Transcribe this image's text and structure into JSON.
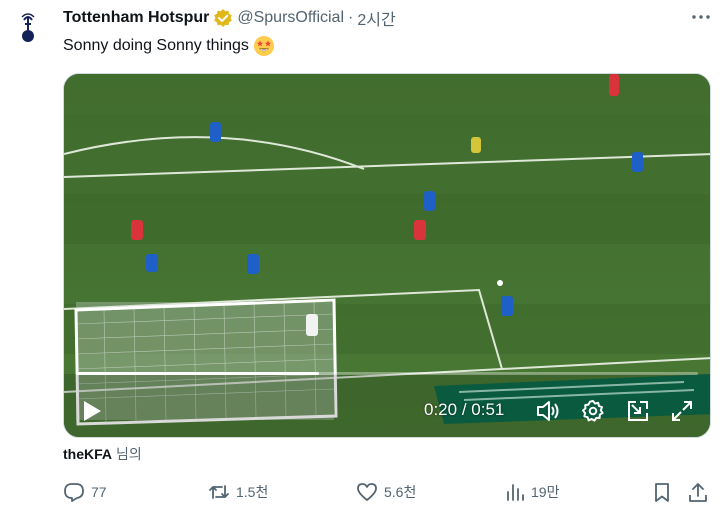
{
  "tweet": {
    "author_name": "Tottenham Hotspur",
    "handle": "@SpursOfficial",
    "separator": "·",
    "time": "2시간",
    "text": "Sonny doing Sonny things",
    "emoji": "star-struck",
    "verified_color": "#e2b719"
  },
  "video": {
    "time_current": "0:20",
    "time_separator": "/",
    "time_total": "0:51",
    "progress": 0.39
  },
  "from": {
    "source": "theKFA",
    "suffix": "님의"
  },
  "actions": {
    "replies": "77",
    "reposts": "1.5천",
    "likes": "5.6천",
    "views": "19만"
  },
  "colors": {
    "text": "#0f1419",
    "muted": "#536471",
    "pitch": "#3d6b2f"
  }
}
